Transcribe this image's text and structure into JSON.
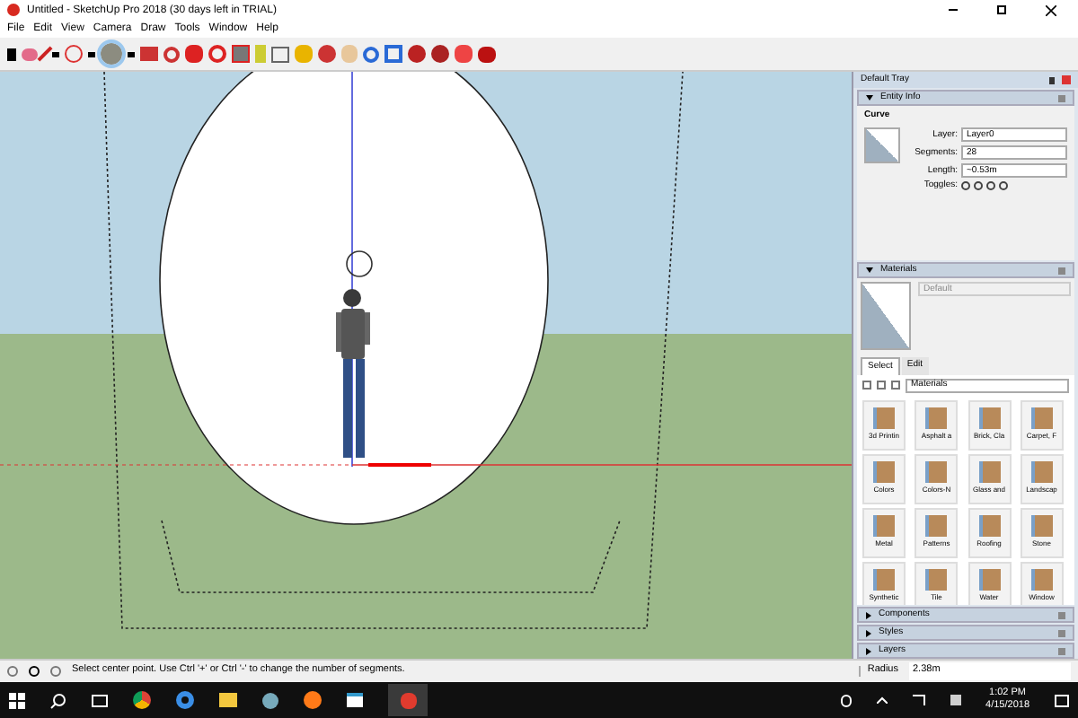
{
  "window": {
    "title": "Untitled - SketchUp Pro 2018 (30 days left in TRIAL)"
  },
  "menu": [
    "File",
    "Edit",
    "View",
    "Camera",
    "Draw",
    "Tools",
    "Window",
    "Help"
  ],
  "tray": {
    "title": "Default Tray",
    "entity_info": {
      "title": "Entity Info",
      "expanded": true,
      "type": "Curve",
      "layer": "Layer0",
      "segments": "28",
      "length": "~0.53m",
      "labels": [
        "Layer:",
        "Segments:",
        "Length:",
        "Toggles:"
      ]
    },
    "materials": {
      "title": "Materials",
      "expanded": true,
      "name": "Default",
      "tabs": [
        {
          "label": "Select",
          "selected": true
        },
        {
          "label": "Edit",
          "selected": false
        }
      ],
      "collection": "Materials",
      "items": [
        "3d Printin",
        "Asphalt a",
        "Brick, Cla",
        "Carpet, F",
        "Colors",
        "Colors-N",
        "Glass and",
        "Landscap",
        "Metal",
        "Patterns",
        "Roofing",
        "Stone",
        "Synthetic",
        "Tile",
        "Water",
        "Window"
      ]
    },
    "collapsed_panels": [
      {
        "title": "Components",
        "expanded": false
      },
      {
        "title": "Styles",
        "expanded": false
      },
      {
        "title": "Layers",
        "expanded": false
      }
    ]
  },
  "status_bar": {
    "message": "Select center point. Use Ctrl '+' or Ctrl '-' to change the number of segments.",
    "measure_label": "Radius",
    "measure_value": "2.38m"
  },
  "taskbar": {
    "time": "1:02 PM",
    "date": "4/15/2018"
  }
}
